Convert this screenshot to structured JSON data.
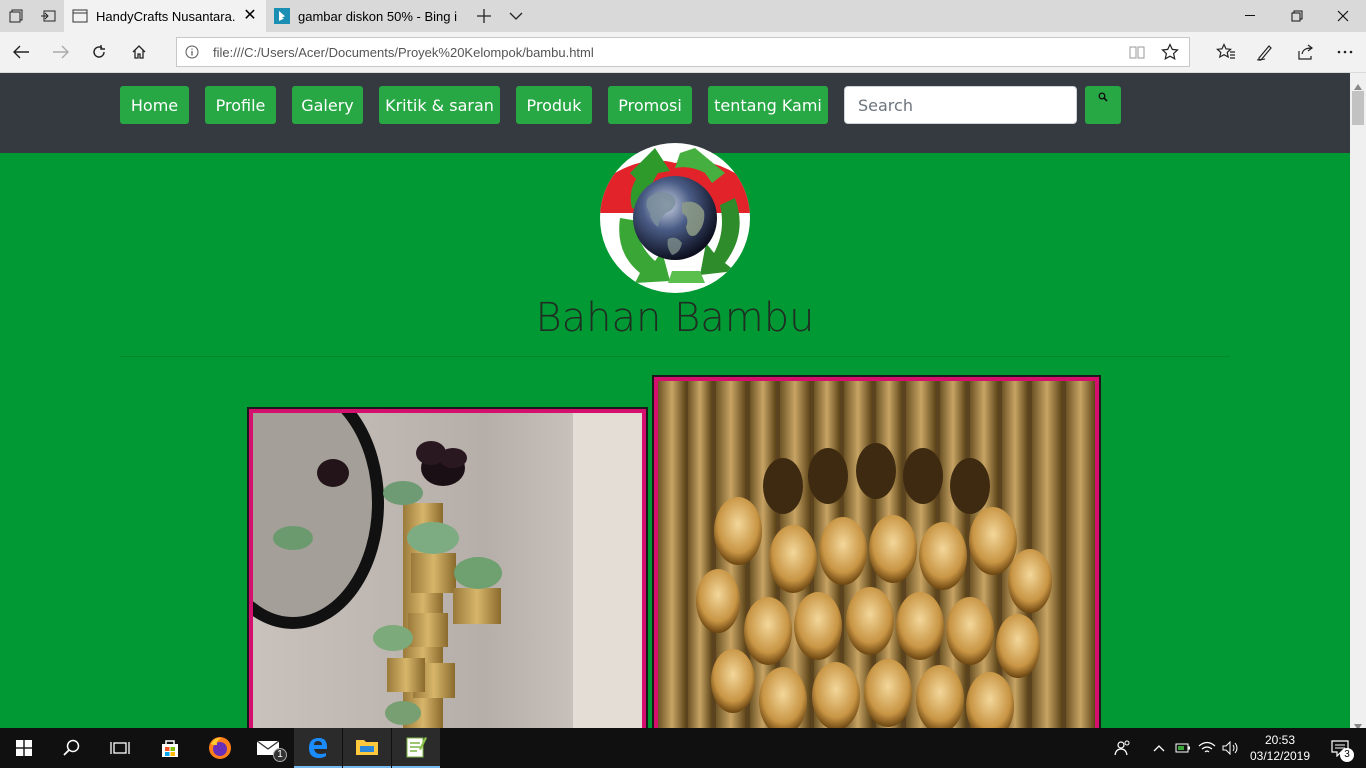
{
  "browser": {
    "tabs": [
      {
        "title": "HandyCrafts Nusantara.",
        "active": true
      },
      {
        "title": "gambar diskon 50% - Bing i",
        "active": false
      }
    ],
    "url": "file:///C:/Users/Acer/Documents/Proyek%20Kelompok/bambu.html"
  },
  "navbar": {
    "items": [
      "Home",
      "Profile",
      "Galery",
      "Kritik & saran",
      "Produk",
      "Promosi",
      "tentang Kami"
    ],
    "search_placeholder": "Search",
    "button_color": "#28a745",
    "bg_color": "#343a40"
  },
  "page": {
    "heading": "Bahan Bambu",
    "background_color": "#009933",
    "photo_border_color": "#d40f6e"
  },
  "taskbar": {
    "mail_badge": "1",
    "time": "20:53",
    "date": "03/12/2019",
    "notification_count": "3"
  }
}
